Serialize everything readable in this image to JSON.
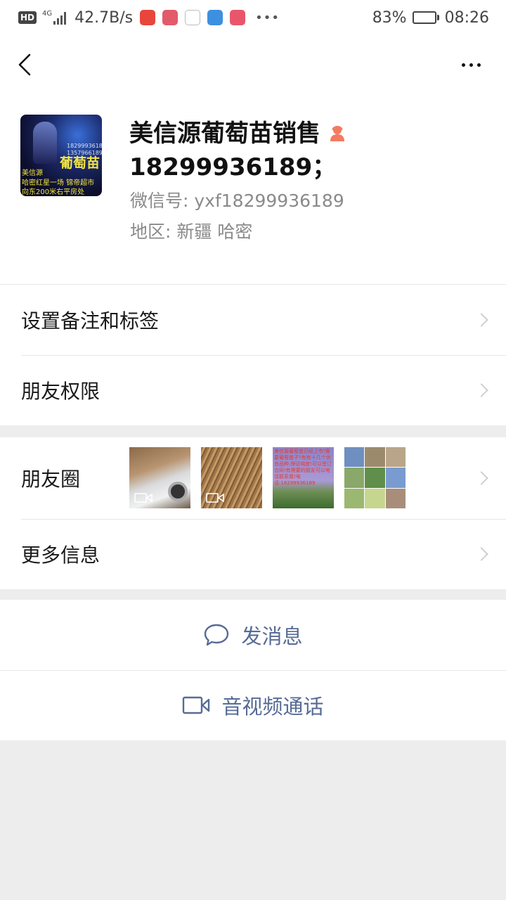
{
  "status_bar": {
    "hd": "HD",
    "network_tag": "4G",
    "speed": "42.7B/s",
    "battery": "83%",
    "battery_level": 0.83,
    "time": "08:26"
  },
  "profile": {
    "name": "美信源葡萄苗销售",
    "name_line2": "18299936189；",
    "wechat_id": "微信号:  yxf18299936189",
    "region": "地区:  新疆  哈密",
    "avatar_text": {
      "phone1": "18299936189",
      "phone2": "13579661898",
      "big": "葡萄苗",
      "line1": "美信源",
      "line2": "哈密红星一场 锦帝超市",
      "line3": "向东200米右平房处"
    },
    "gender_color": "#fa5151"
  },
  "menu": {
    "remark_tags": "设置备注和标签",
    "permissions": "朋友权限",
    "moments": "朋友圈",
    "more_info": "更多信息"
  },
  "moments_thumb3_text": "美信源葡萄苗已经上市!需要葡萄苗子?有有十几个优良品种,保证纯度!可以签订合同!有需要的朋友可以电话联系我!电话:18299936189",
  "actions": {
    "send_message": "发消息",
    "video_call": "音视频通话"
  },
  "colors": {
    "link": "#576b95",
    "background": "#ededed"
  }
}
